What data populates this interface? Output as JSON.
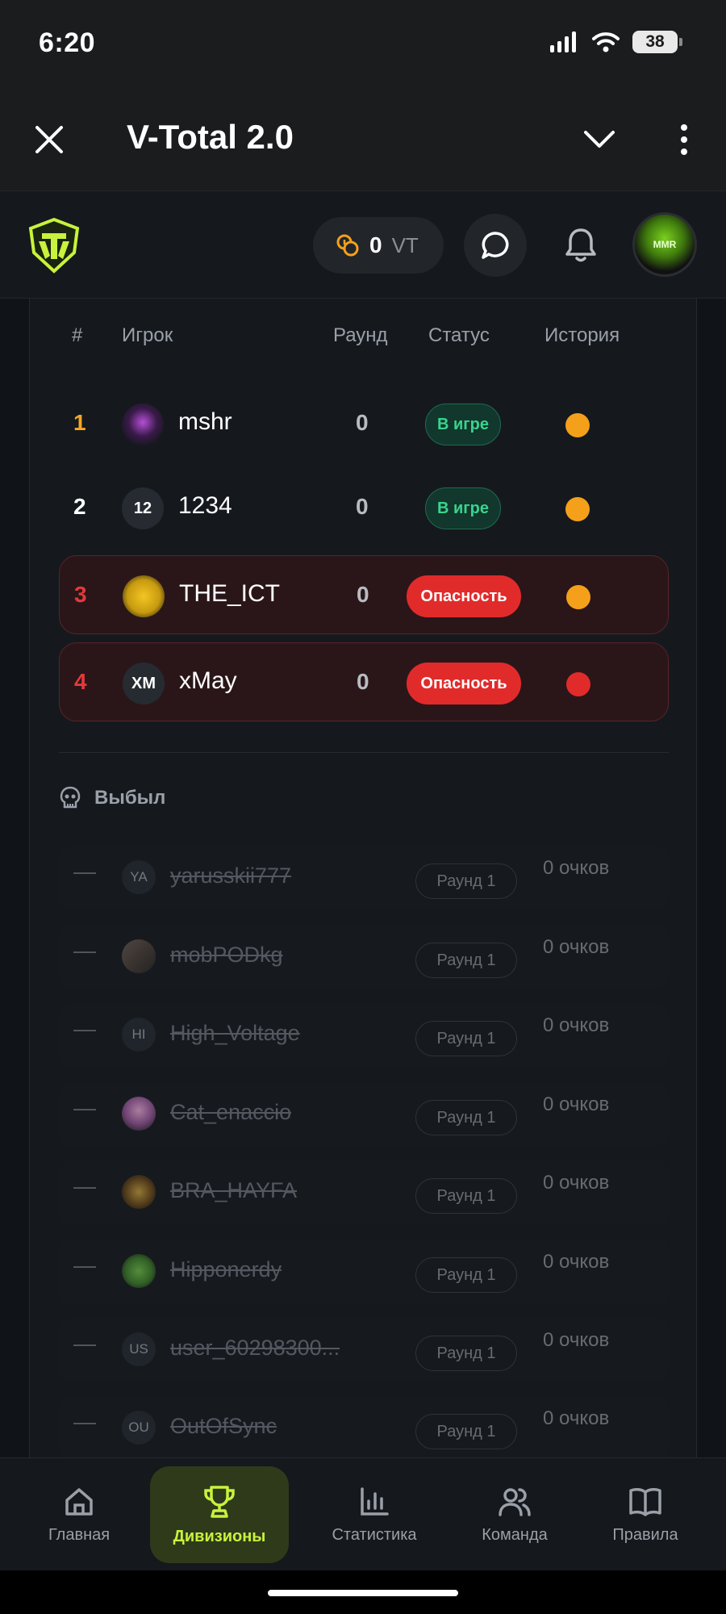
{
  "status_bar": {
    "time": "6:20",
    "battery": "38"
  },
  "app_bar": {
    "title": "V-Total 2.0"
  },
  "header": {
    "balance_amount": "0",
    "balance_currency": "VT",
    "avatar_text": "MMR"
  },
  "table": {
    "headers": {
      "rank": "#",
      "player": "Игрок",
      "round": "Раунд",
      "status": "Статус",
      "history": "История"
    },
    "rows": [
      {
        "rank": "1",
        "rank_color": "#f5a623",
        "avatar": "",
        "name": "mshr",
        "round": "0",
        "status": "В игре",
        "status_type": "ingame",
        "history_color": "#f5a01a"
      },
      {
        "rank": "2",
        "rank_color": "#ffffff",
        "avatar": "12",
        "name": "1234",
        "round": "0",
        "status": "В игре",
        "status_type": "ingame",
        "history_color": "#f5a01a"
      },
      {
        "rank": "3",
        "rank_color": "#e3393a",
        "avatar": "",
        "name": "THE_ICT",
        "round": "0",
        "status": "Опасность",
        "status_type": "danger",
        "history_color": "#f5a01a"
      },
      {
        "rank": "4",
        "rank_color": "#e3393a",
        "avatar": "XM",
        "name": "xMay",
        "round": "0",
        "status": "Опасность",
        "status_type": "danger",
        "history_color": "#e12b2b"
      }
    ]
  },
  "eliminated": {
    "title": "Выбыл",
    "rows": [
      {
        "dash": "—",
        "avatar": "YA",
        "name": "yarusskii777",
        "round": "Раунд 1",
        "points": "0 очков"
      },
      {
        "dash": "—",
        "avatar": "",
        "name": "mobPODkg",
        "round": "Раунд 1",
        "points": "0 очков"
      },
      {
        "dash": "—",
        "avatar": "HI",
        "name": "High_Voltage",
        "round": "Раунд 1",
        "points": "0 очков"
      },
      {
        "dash": "—",
        "avatar": "",
        "name": "Cat_enaccio",
        "round": "Раунд 1",
        "points": "0 очков"
      },
      {
        "dash": "—",
        "avatar": "",
        "name": "BRA_HAYFA",
        "round": "Раунд 1",
        "points": "0 очков"
      },
      {
        "dash": "—",
        "avatar": "",
        "name": "Hipponerdy",
        "round": "Раунд 1",
        "points": "0 очков"
      },
      {
        "dash": "—",
        "avatar": "US",
        "name": "user_60298300...",
        "round": "Раунд 1",
        "points": "0 очков"
      },
      {
        "dash": "—",
        "avatar": "OU",
        "name": "OutOfSync",
        "round": "Раунд 1",
        "points": "0 очков"
      }
    ]
  },
  "nav": {
    "home": "Главная",
    "divisions": "Дивизионы",
    "stats": "Статистика",
    "team": "Команда",
    "rules": "Правила"
  },
  "colors": {
    "accent": "#c8f23d",
    "danger": "#e12b2b",
    "ingame": "#3ad38d",
    "warning": "#f5a01a"
  }
}
